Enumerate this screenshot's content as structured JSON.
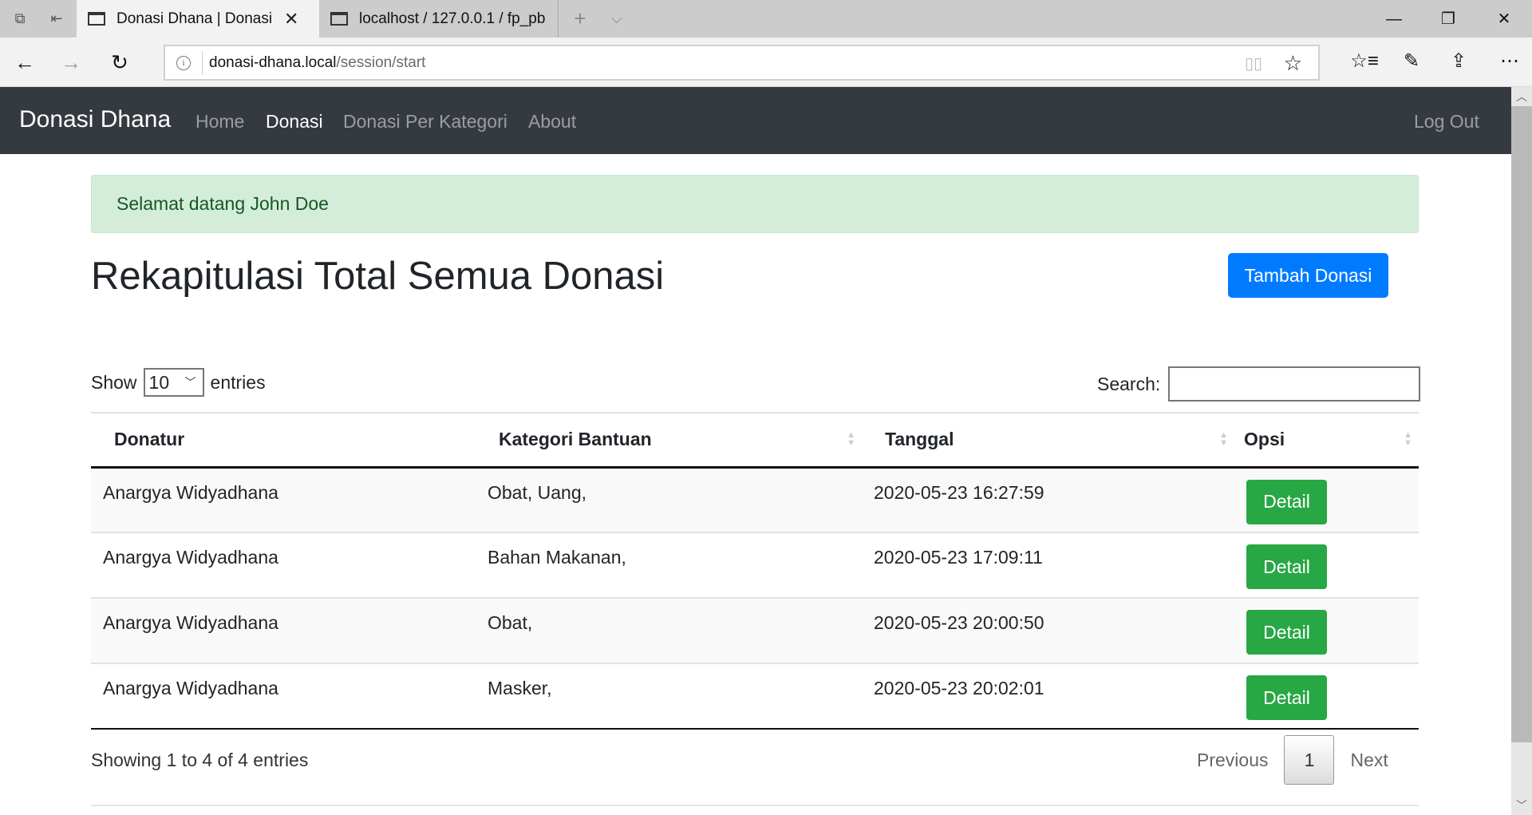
{
  "browser": {
    "tabs": [
      {
        "title": "Donasi Dhana | Donasi Dhana",
        "active": true
      },
      {
        "title": "localhost / 127.0.0.1 / fp_pb",
        "active": false
      }
    ],
    "new_tab_icon": "+",
    "tab_list_icon": "⌵",
    "window": {
      "minimize": "—",
      "restore": "❐",
      "close": "✕"
    },
    "nav": {
      "back": "←",
      "forward": "→",
      "refresh": "↻"
    },
    "address": {
      "domain": "donasi-dhana.local",
      "path": "/session/start",
      "info_icon": "i"
    },
    "reader_icon": "📖",
    "favorite_icon": "☆",
    "toolbar": {
      "favorites": "☆≡",
      "notes": "✎",
      "share": "⇪",
      "more": "⋯"
    }
  },
  "navbar": {
    "brand": "Donasi Dhana",
    "links": [
      {
        "label": "Home",
        "active": false
      },
      {
        "label": "Donasi",
        "active": true
      },
      {
        "label": "Donasi Per Kategori",
        "active": false
      },
      {
        "label": "About",
        "active": false
      }
    ],
    "logout": "Log Out"
  },
  "alert": {
    "text": "Selamat datang John Doe"
  },
  "page": {
    "title": "Rekapitulasi Total Semua Donasi",
    "add_button": "Tambah Donasi"
  },
  "datatable": {
    "length": {
      "prefix": "Show",
      "value": "10",
      "suffix": "entries"
    },
    "search": {
      "label": "Search:",
      "value": "",
      "placeholder": ""
    },
    "columns": [
      "Donatur",
      "Kategori Bantuan",
      "Tanggal",
      "Opsi"
    ],
    "rows": [
      {
        "donatur": "Anargya Widyadhana",
        "kategori": "Obat, Uang,",
        "tanggal": "2020-05-23 16:27:59",
        "opsi": "Detail"
      },
      {
        "donatur": "Anargya Widyadhana",
        "kategori": "Bahan Makanan,",
        "tanggal": "2020-05-23 17:09:11",
        "opsi": "Detail"
      },
      {
        "donatur": "Anargya Widyadhana",
        "kategori": "Obat,",
        "tanggal": "2020-05-23 20:00:50",
        "opsi": "Detail"
      },
      {
        "donatur": "Anargya Widyadhana",
        "kategori": "Masker,",
        "tanggal": "2020-05-23 20:02:01",
        "opsi": "Detail"
      }
    ],
    "info": "Showing 1 to 4 of 4 entries",
    "pagination": {
      "previous": "Previous",
      "current": "1",
      "next": "Next"
    }
  },
  "colors": {
    "navbar_bg": "#343a40",
    "primary": "#007bff",
    "success": "#28a745",
    "alert_bg": "#d4edda",
    "alert_text": "#155724"
  }
}
